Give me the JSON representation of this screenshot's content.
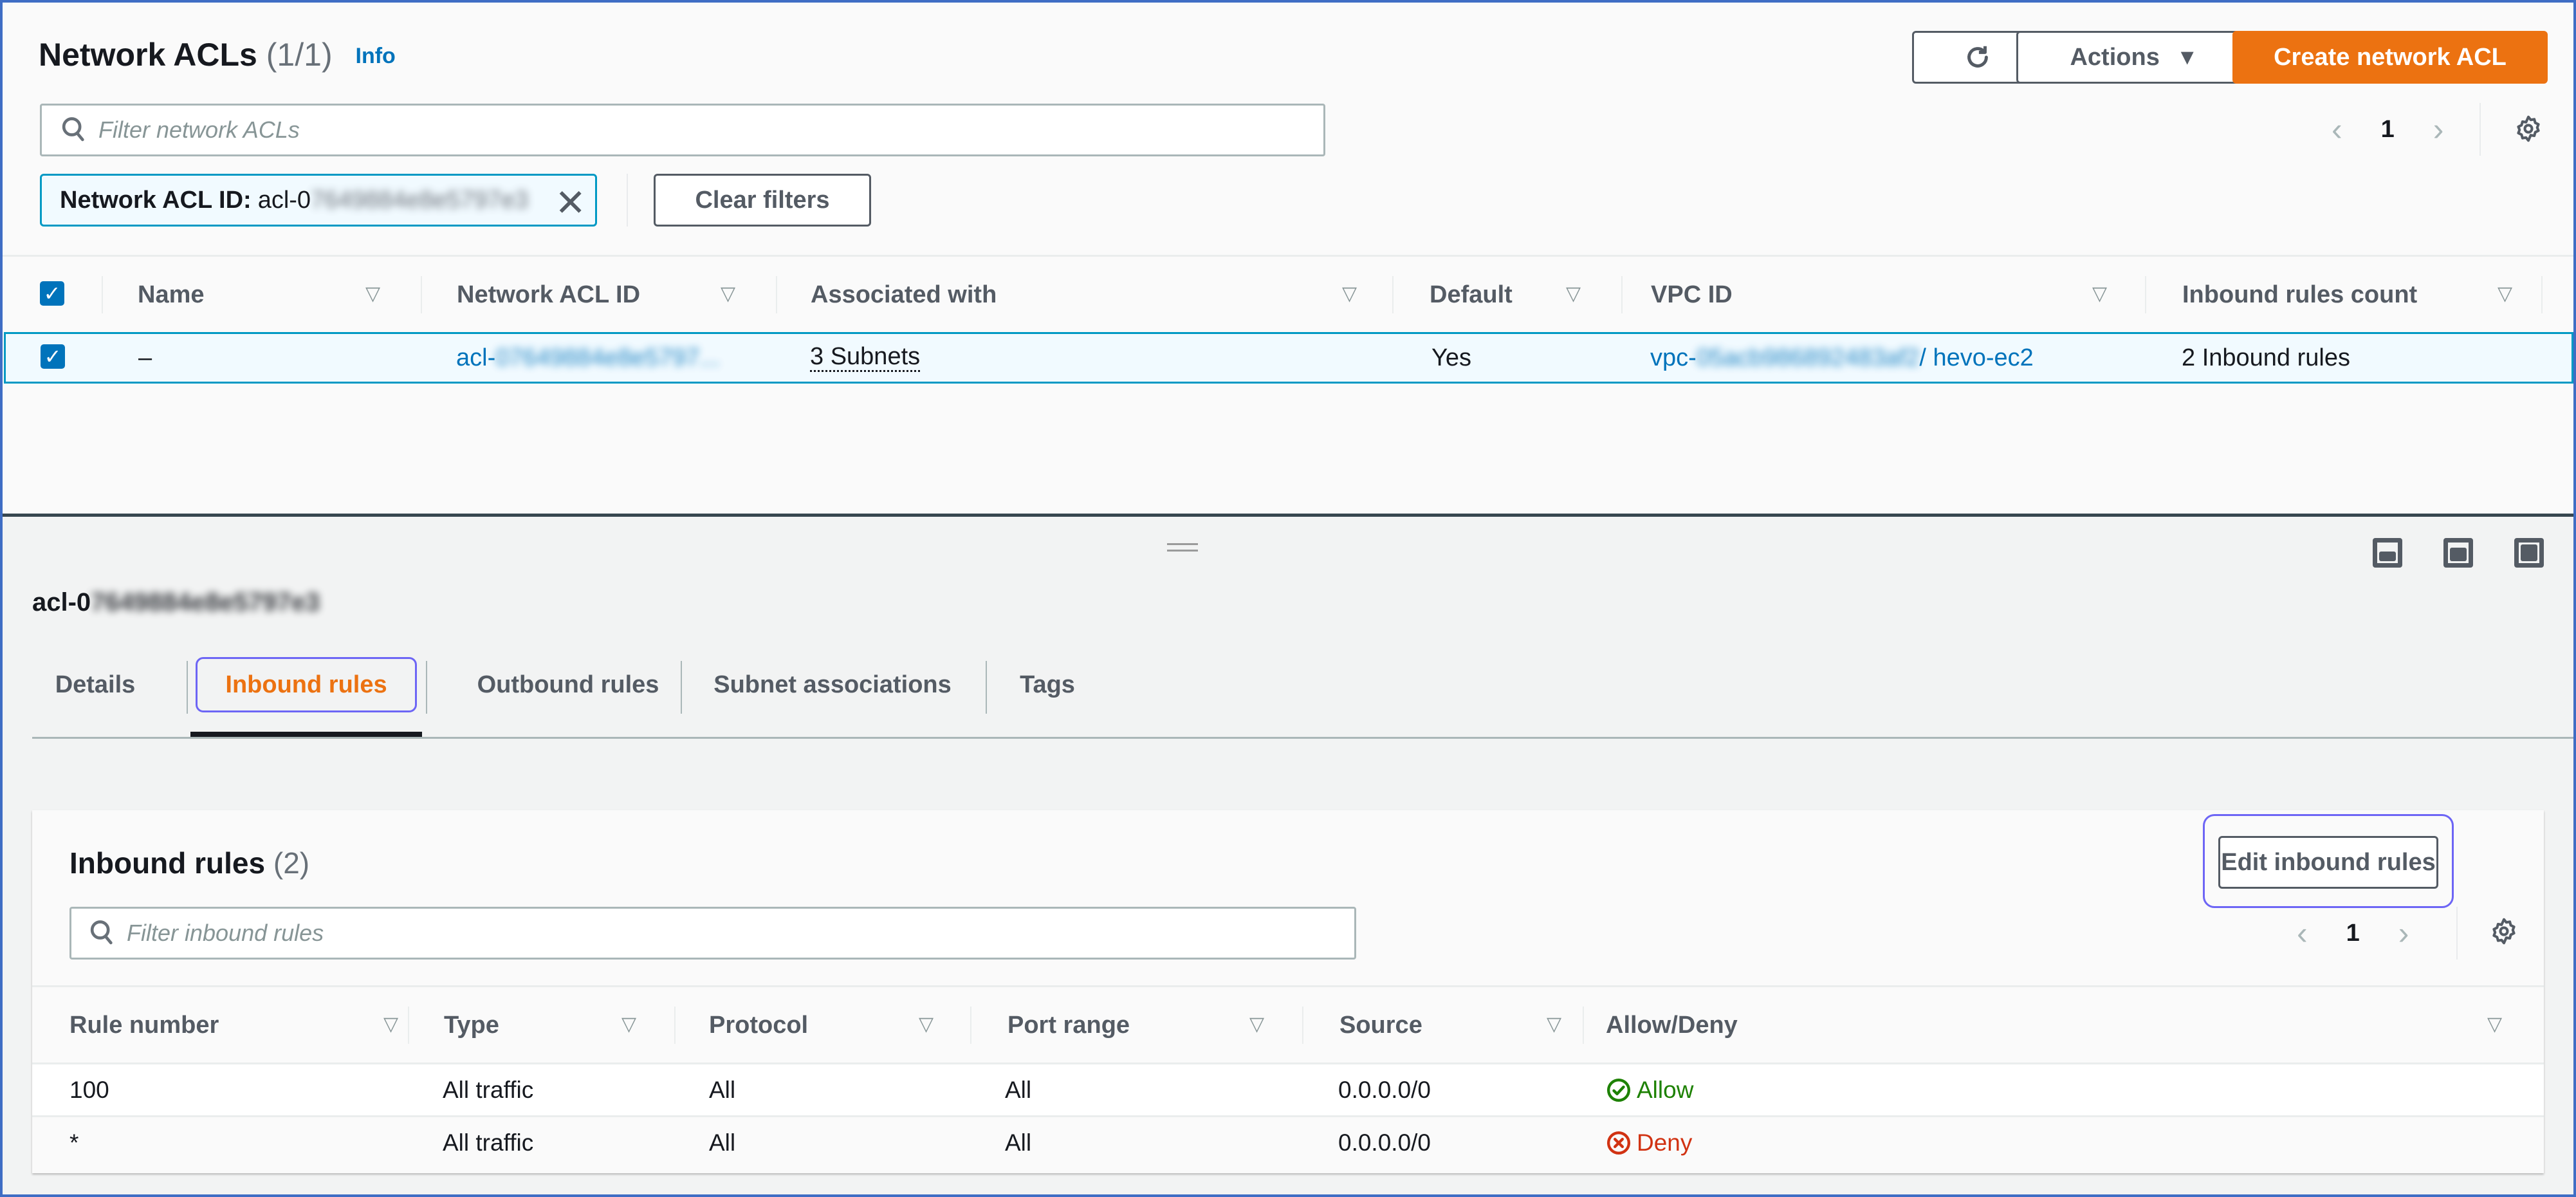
{
  "header": {
    "title": "Network ACLs",
    "count": "(1/1)",
    "info_label": "Info",
    "actions_label": "Actions",
    "create_label": "Create network ACL",
    "search_placeholder": "Filter network ACLs",
    "page": "1",
    "filter_token_label": "Network ACL ID:",
    "filter_token_value": "acl-0",
    "filter_token_redacted": "7649884e8e5797e3",
    "clear_filters_label": "Clear filters"
  },
  "acl_table": {
    "columns": [
      "Name",
      "Network ACL ID",
      "Associated with",
      "Default",
      "VPC ID",
      "Inbound rules count"
    ],
    "rows": [
      {
        "selected": true,
        "name": "–",
        "acl_id_prefix": "acl-",
        "acl_id_redacted": "07649884e8e5797...",
        "associated_with": "3 Subnets",
        "default": "Yes",
        "vpc_prefix": "vpc-",
        "vpc_redacted": "05acb986892483af2",
        "vpc_name": " / hevo-ec2",
        "inbound_rules_count": "2 Inbound rules"
      }
    ]
  },
  "detail": {
    "title_prefix": "acl-0",
    "title_redacted": "7649884e8e5797e3",
    "tabs": [
      {
        "label": "Details",
        "active": false
      },
      {
        "label": "Inbound rules",
        "active": true
      },
      {
        "label": "Outbound rules",
        "active": false
      },
      {
        "label": "Subnet associations",
        "active": false
      },
      {
        "label": "Tags",
        "active": false
      }
    ]
  },
  "inbound_rules": {
    "title": "Inbound rules",
    "count": "(2)",
    "edit_label": "Edit inbound rules",
    "search_placeholder": "Filter inbound rules",
    "page": "1",
    "columns": [
      "Rule number",
      "Type",
      "Protocol",
      "Port range",
      "Source",
      "Allow/Deny"
    ],
    "rows": [
      {
        "rule_number": "100",
        "type": "All traffic",
        "protocol": "All",
        "port_range": "All",
        "source": "0.0.0.0/0",
        "action": "Allow",
        "status": "allow"
      },
      {
        "rule_number": "*",
        "type": "All traffic",
        "protocol": "All",
        "port_range": "All",
        "source": "0.0.0.0/0",
        "action": "Deny",
        "status": "deny"
      }
    ]
  },
  "colors": {
    "primary": "#ec7211",
    "link": "#0073bb",
    "selected_border": "#0099c4",
    "focus_ring": "#6d65f5",
    "allow": "#1d8102",
    "deny": "#d13212"
  }
}
